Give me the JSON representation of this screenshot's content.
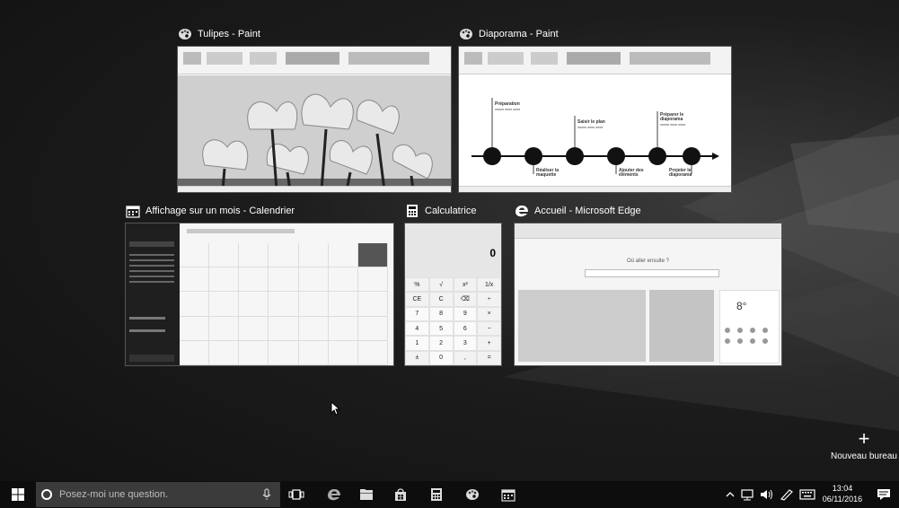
{
  "windows": {
    "tulipes": {
      "title": "Tulipes - Paint",
      "icon": "paint-palette-icon"
    },
    "diaporama": {
      "title": "Diaporama - Paint",
      "icon": "paint-palette-icon",
      "slide_steps": [
        {
          "label": "Préparation"
        },
        {
          "label": "Saisir le plan"
        },
        {
          "label": "Préparer le diaporama"
        },
        {
          "label": "Réaliser la maquette"
        },
        {
          "label": "Ajouter des éléments"
        },
        {
          "label": "Projeter le diaporama"
        }
      ]
    },
    "calendrier": {
      "title": "Affichage sur un mois - Calendrier",
      "icon": "calendar-icon"
    },
    "calculatrice": {
      "title": "Calculatrice",
      "icon": "calculator-icon",
      "display": "0"
    },
    "edge": {
      "title": "Accueil - Microsoft Edge",
      "icon": "edge-icon",
      "question": "Où aller ensuite ?",
      "temp": "8°"
    }
  },
  "new_desktop": {
    "label": "Nouveau bureau",
    "icon": "plus-icon"
  },
  "taskbar": {
    "search_placeholder": "Posez-moi une question.",
    "time": "13:04",
    "date": "06/11/2016"
  },
  "calc_keys": [
    "%",
    "√",
    "x²",
    "1/x",
    "CE",
    "C",
    "⌫",
    "÷",
    "7",
    "8",
    "9",
    "×",
    "4",
    "5",
    "6",
    "−",
    "1",
    "2",
    "3",
    "+",
    "±",
    "0",
    ",",
    "="
  ]
}
